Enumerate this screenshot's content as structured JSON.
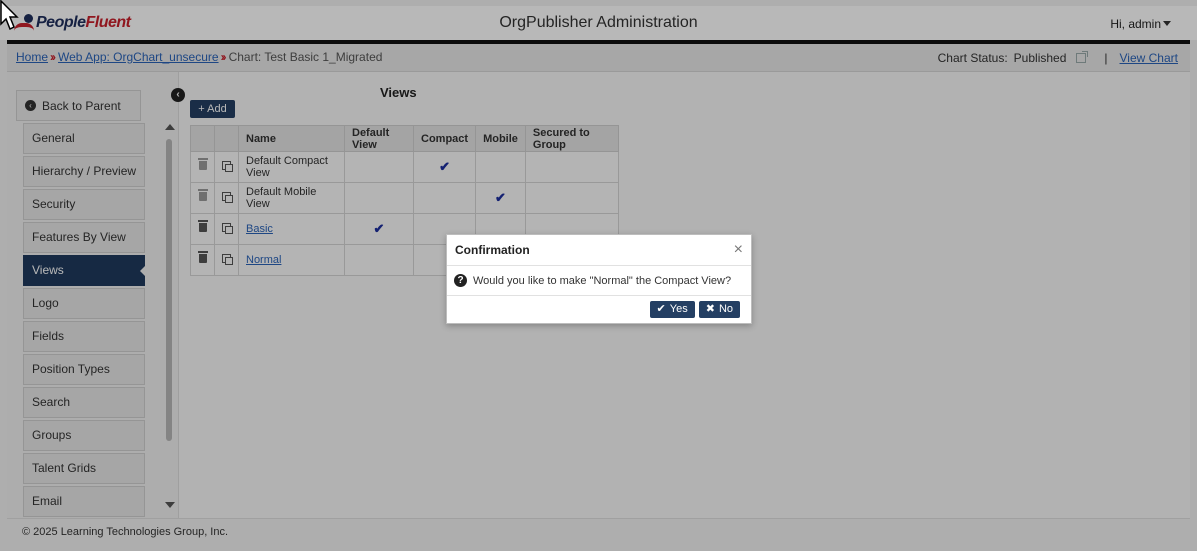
{
  "header": {
    "logo_text_a": "People",
    "logo_text_b": "Fluent",
    "app_title": "OrgPublisher Administration",
    "user_label": "Hi,  admin"
  },
  "breadcrumb": {
    "home": "Home",
    "web_app": "Web App: OrgChart_unsecure",
    "current": "Chart: Test Basic 1_Migrated",
    "separator": "››"
  },
  "chart_status": {
    "label": "Chart Status:",
    "value": "Published",
    "divider": "|",
    "view_chart": "View Chart"
  },
  "sidebar": {
    "back_label": "Back to Parent",
    "items": [
      {
        "label": "General",
        "active": false
      },
      {
        "label": "Hierarchy / Preview",
        "active": false
      },
      {
        "label": "Security",
        "active": false
      },
      {
        "label": "Features By View",
        "active": false
      },
      {
        "label": "Views",
        "active": true
      },
      {
        "label": "Logo",
        "active": false
      },
      {
        "label": "Fields",
        "active": false
      },
      {
        "label": "Position Types",
        "active": false
      },
      {
        "label": "Search",
        "active": false
      },
      {
        "label": "Groups",
        "active": false
      },
      {
        "label": "Talent Grids",
        "active": false
      },
      {
        "label": "Email",
        "active": false
      }
    ]
  },
  "views": {
    "title": "Views",
    "add_label": "Add",
    "columns": [
      "Name",
      "Default View",
      "Compact",
      "Mobile",
      "Secured to Group"
    ],
    "rows": [
      {
        "name": "Default Compact View",
        "link": false,
        "default_view": false,
        "compact": true,
        "mobile": false,
        "trash_disabled": true
      },
      {
        "name": "Default Mobile View",
        "link": false,
        "default_view": false,
        "compact": false,
        "mobile": true,
        "trash_disabled": true
      },
      {
        "name": "Basic",
        "link": true,
        "default_view": true,
        "compact": false,
        "mobile": false,
        "trash_disabled": false
      },
      {
        "name": "Normal",
        "link": true,
        "default_view": false,
        "compact": false,
        "mobile": false,
        "trash_disabled": false
      }
    ]
  },
  "dialog": {
    "title": "Confirmation",
    "close": "×",
    "message": "Would you like to make \"Normal\" the Compact View?",
    "yes_label": "Yes",
    "no_label": "No"
  },
  "footer": {
    "copyright": "© 2025 Learning Technologies Group, Inc."
  },
  "icons": {
    "check": "✔",
    "plus": "+",
    "collapse": "‹",
    "back": "‹",
    "question": "?"
  },
  "colors": {
    "primary": "#243f63",
    "active_nav": "#1f3a5e",
    "link": "#2a63b8",
    "brand_red": "#c8202c",
    "check": "#1d2f9e"
  }
}
